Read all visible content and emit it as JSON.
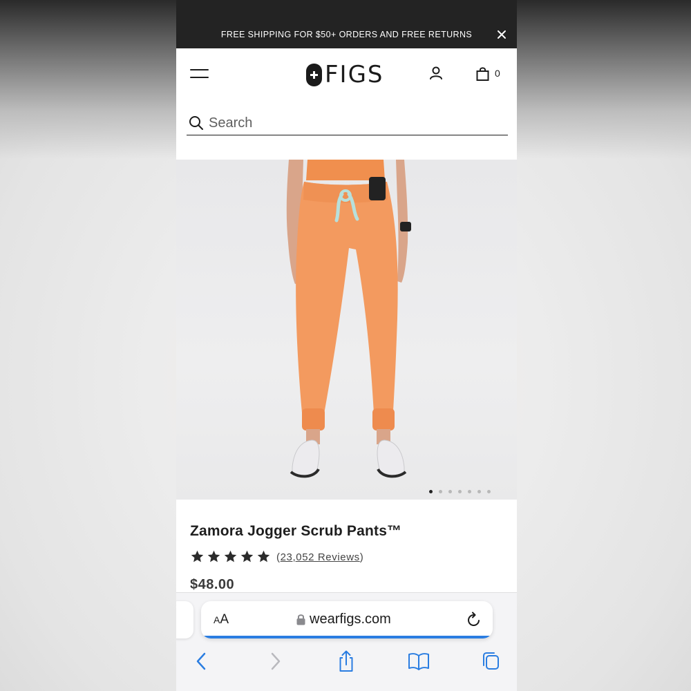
{
  "promo": {
    "text": "FREE SHIPPING FOR $50+ ORDERS AND FREE RETURNS",
    "close_icon": "close-icon"
  },
  "header": {
    "logo_text": "FIGS",
    "cart_count": "0",
    "icons": [
      "hamburger-menu-icon",
      "account-icon",
      "shopping-bag-icon"
    ]
  },
  "search": {
    "placeholder": "Search",
    "value": ""
  },
  "product": {
    "image_count": 7,
    "active_image_index": 0,
    "title": "Zamora Jogger Scrub Pants™",
    "rating": 4.5,
    "rating_max": 5,
    "reviews_prefix": "(",
    "reviews_count": "23,052 Reviews",
    "reviews_suffix": ")",
    "price": "$48.00",
    "color": "#f39a5f"
  },
  "browser": {
    "text_size_label_small": "A",
    "text_size_label_large": "A",
    "domain": "wearfigs.com",
    "load_progress": 1.0,
    "accent": "#2a7de1",
    "toolbar": [
      "back-icon",
      "forward-icon",
      "share-icon",
      "bookmarks-icon",
      "tabs-icon"
    ]
  }
}
